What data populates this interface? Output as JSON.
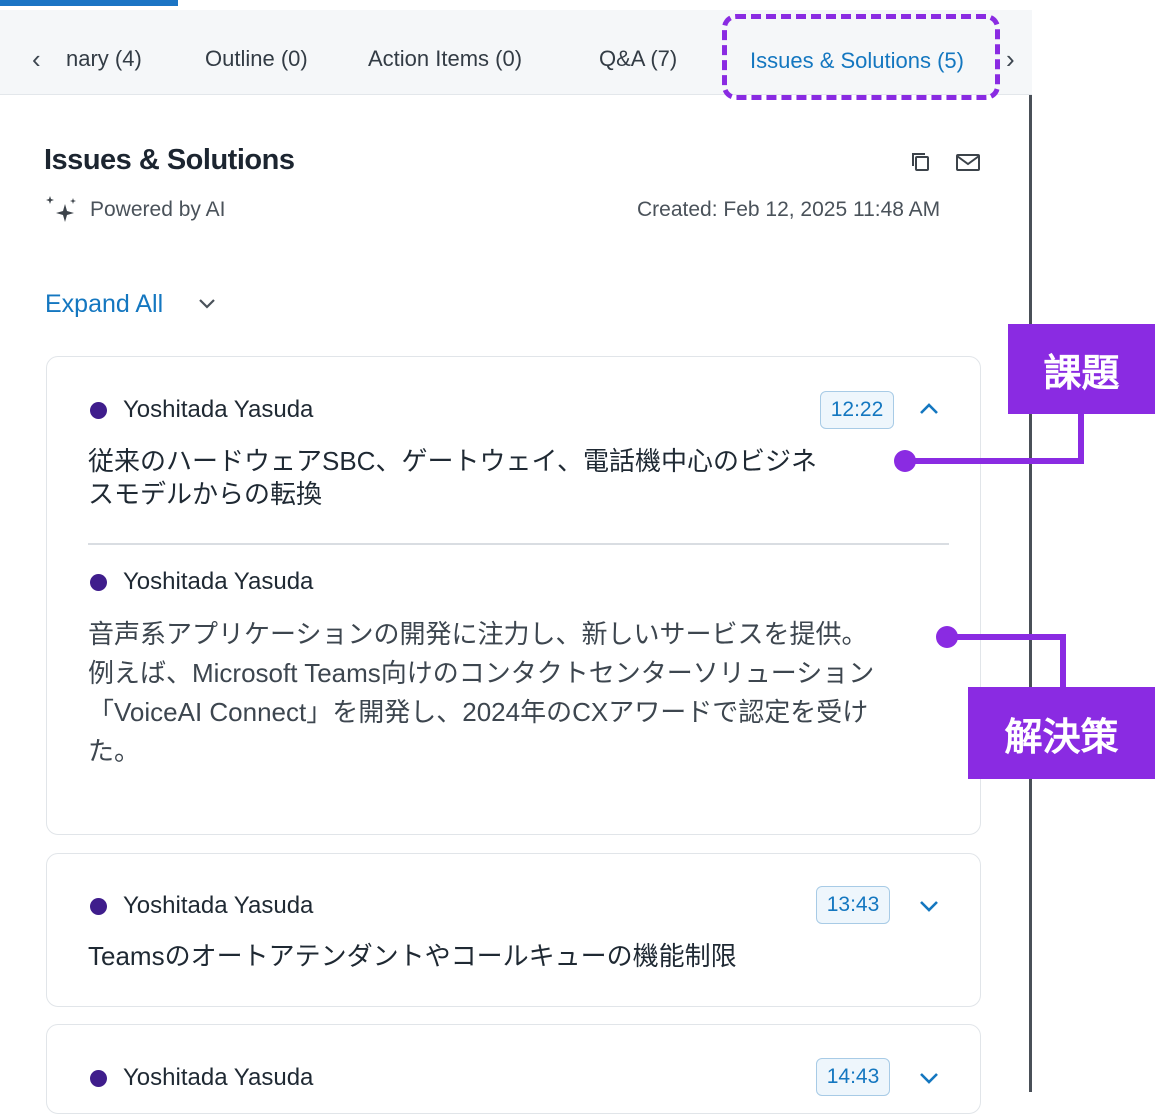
{
  "tabs": {
    "items": [
      {
        "label": "nary (4)"
      },
      {
        "label": "Outline (0)"
      },
      {
        "label": "Action Items (0)"
      },
      {
        "label": "Q&A (7)"
      },
      {
        "label": "Issues & Solutions (5)"
      }
    ],
    "active": "Issues & Solutions (5)"
  },
  "header": {
    "title": "Issues & Solutions",
    "powered_by": "Powered by AI",
    "created": "Created: Feb 12, 2025 11:48 AM"
  },
  "expand_all": "Expand All",
  "cards": [
    {
      "issue": {
        "author": "Yoshitada Yasuda",
        "timestamp": "12:22",
        "text_line1": "従来のハードウェアSBC、ゲートウェイ、電話機中心のビジネ",
        "text_line2": "スモデルからの転換"
      },
      "solution": {
        "author": "Yoshitada Yasuda",
        "text_line1": "音声系アプリケーションの開発に注力し、新しいサービスを提供。",
        "text_line2": "例えば、Microsoft Teams向けのコンタクトセンターソリューション",
        "text_line3": "「VoiceAI Connect」を開発し、2024年のCXアワードで認定を受け",
        "text_line4": "た。"
      },
      "expanded": true
    },
    {
      "issue": {
        "author": "Yoshitada Yasuda",
        "timestamp": "13:43",
        "text_line1": "Teamsのオートアテンダントやコールキューの機能制限"
      },
      "expanded": false
    },
    {
      "issue": {
        "author": "Yoshitada Yasuda",
        "timestamp": "14:43"
      },
      "expanded": false
    }
  ],
  "annotations": {
    "issue_label": "課題",
    "solution_label": "解決策"
  },
  "colors": {
    "accent": "#1477c0",
    "annotation": "#8a2be2",
    "author_dot": "#3f1d8c"
  }
}
